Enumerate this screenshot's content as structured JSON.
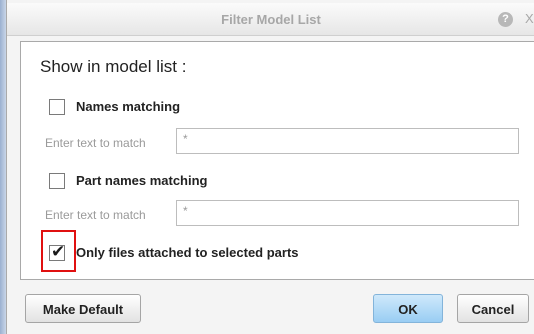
{
  "window": {
    "title": "Filter Model List",
    "help_icon": "question-icon",
    "close_icon": "close-icon",
    "close_glyph": "X"
  },
  "filter": {
    "heading": "Show in model list :",
    "names_matching": {
      "label": "Names matching",
      "checked": false,
      "input_label": "Enter text to match",
      "value": "*"
    },
    "part_names_matching": {
      "label": "Part names matching",
      "checked": false,
      "input_label": "Enter text to match",
      "value": "*"
    },
    "only_attached": {
      "label": "Only files attached to selected parts",
      "checked": true
    }
  },
  "buttons": {
    "make_default": "Make Default",
    "ok": "OK",
    "cancel": "Cancel"
  },
  "colors": {
    "highlight": "#e01010",
    "primary_button": "#a9d6f6"
  }
}
